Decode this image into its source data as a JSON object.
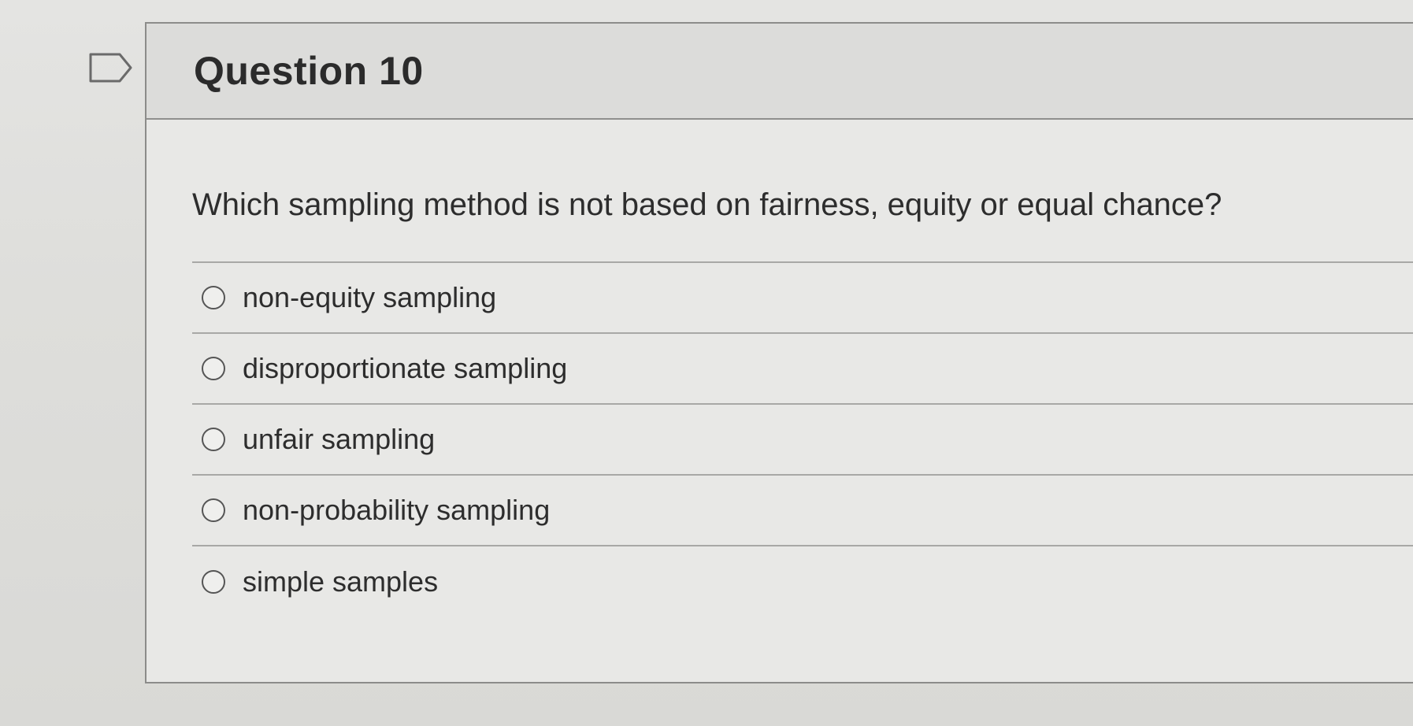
{
  "question": {
    "title": "Question 10",
    "text": "Which sampling method is not based on fairness, equity or equal chance?",
    "answers": [
      {
        "label": "non-equity sampling"
      },
      {
        "label": "disproportionate sampling"
      },
      {
        "label": "unfair sampling"
      },
      {
        "label": "non-probability sampling"
      },
      {
        "label": "simple samples"
      }
    ]
  },
  "icons": {
    "flag": "flag-question-icon"
  }
}
